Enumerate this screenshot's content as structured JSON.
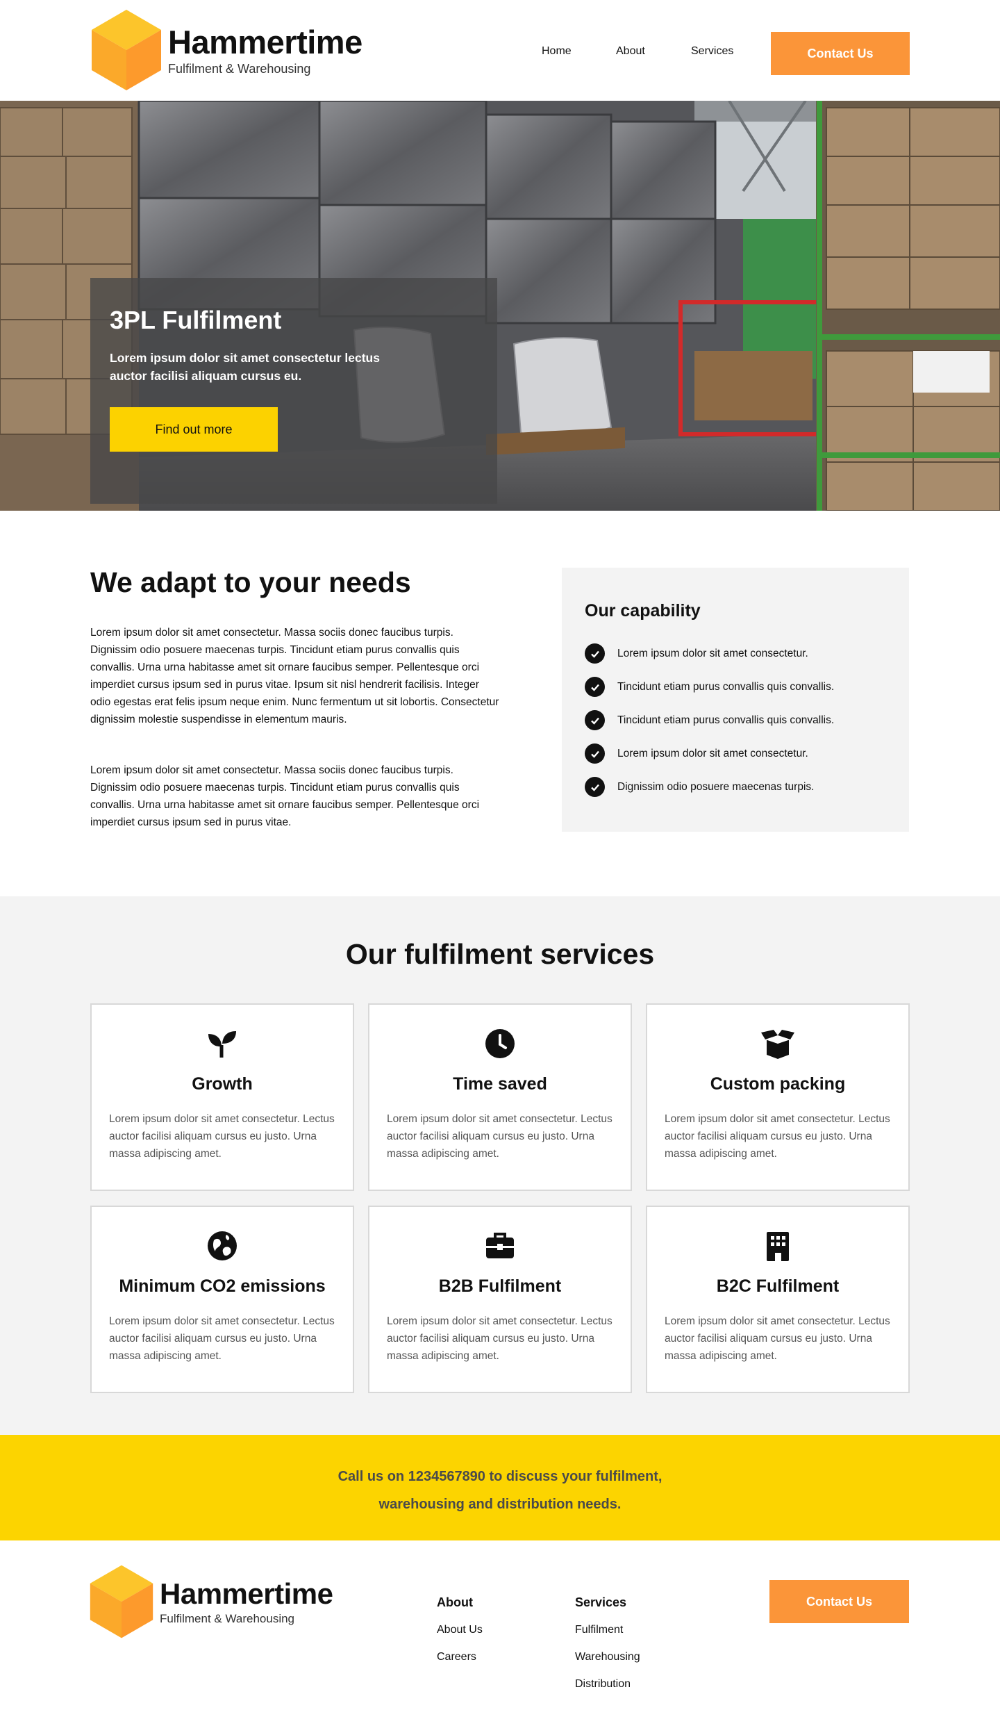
{
  "header": {
    "brand_name": "Hammertime",
    "brand_tagline": "Fulfilment & Warehousing",
    "nav": [
      "Home",
      "About",
      "Services"
    ],
    "contact_button": "Contact Us"
  },
  "hero": {
    "title": "3PL Fulfilment",
    "text": "Lorem ipsum dolor sit amet consectetur lectus auctor facilisi aliquam cursus eu.",
    "button": "Find out more"
  },
  "adapt": {
    "title": "We adapt to your needs",
    "paragraph1": "Lorem ipsum dolor sit amet consectetur. Massa sociis donec faucibus turpis. Dignissim odio posuere maecenas turpis. Tincidunt etiam purus convallis quis convallis. Urna urna habitasse amet sit ornare faucibus semper. Pellentesque orci imperdiet cursus ipsum sed in purus vitae. Ipsum sit nisl hendrerit facilisis. Integer odio egestas erat felis ipsum neque enim. Nunc fermentum ut sit lobortis. Consectetur dignissim molestie suspendisse in elementum mauris.",
    "paragraph2": "Lorem ipsum dolor sit amet consectetur. Massa sociis donec faucibus turpis. Dignissim odio posuere maecenas turpis. Tincidunt etiam purus convallis quis convallis. Urna urna habitasse amet sit ornare faucibus semper. Pellentesque orci imperdiet cursus ipsum sed in purus vitae."
  },
  "capability": {
    "title": "Our capability",
    "items": [
      "Lorem ipsum dolor sit amet consectetur.",
      "Tincidunt etiam purus convallis quis convallis.",
      "Tincidunt etiam purus convallis quis convallis.",
      "Lorem ipsum dolor sit amet consectetur.",
      "Dignissim odio posuere maecenas turpis."
    ]
  },
  "services": {
    "title": "Our fulfilment services",
    "cards": [
      {
        "title": "Growth",
        "icon": "sprout-icon",
        "text": "Lorem ipsum dolor sit amet consectetur. Lectus auctor facilisi aliquam cursus eu justo. Urna massa adipiscing amet."
      },
      {
        "title": "Time saved",
        "icon": "clock-icon",
        "text": "Lorem ipsum dolor sit amet consectetur. Lectus auctor facilisi aliquam cursus eu justo. Urna massa adipiscing amet."
      },
      {
        "title": "Custom packing",
        "icon": "open-box-icon",
        "text": "Lorem ipsum dolor sit amet consectetur. Lectus auctor facilisi aliquam cursus eu justo. Urna massa adipiscing amet."
      },
      {
        "title": "Minimum CO2 emissions",
        "icon": "globe-icon",
        "text": "Lorem ipsum dolor sit amet consectetur. Lectus auctor facilisi aliquam cursus eu justo. Urna massa adipiscing amet."
      },
      {
        "title": "B2B Fulfilment",
        "icon": "briefcase-icon",
        "text": "Lorem ipsum dolor sit amet consectetur. Lectus auctor facilisi aliquam cursus eu justo. Urna massa adipiscing amet."
      },
      {
        "title": "B2C Fulfilment",
        "icon": "building-icon",
        "text": "Lorem ipsum dolor sit amet consectetur. Lectus auctor facilisi aliquam cursus eu justo. Urna massa adipiscing amet."
      }
    ]
  },
  "cta": {
    "line1": "Call us on 1234567890 to discuss your fulfilment,",
    "line2": "warehousing and distribution needs."
  },
  "footer": {
    "brand_name": "Hammertime",
    "brand_tagline": "Fulfilment & Warehousing",
    "about_title": "About",
    "about_links": [
      "About Us",
      "Careers"
    ],
    "services_title": "Services",
    "services_links": [
      "Fulfilment",
      "Warehousing",
      "Distribution"
    ],
    "contact_button": "Contact Us"
  },
  "colors": {
    "accent_orange": "#fb9539",
    "accent_yellow": "#fcd400",
    "panel_grey": "#f3f3f3"
  }
}
